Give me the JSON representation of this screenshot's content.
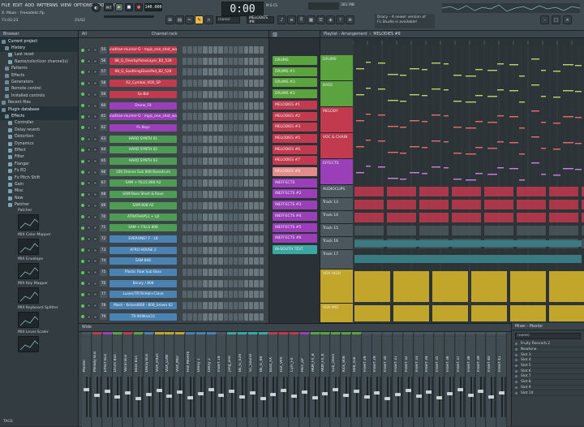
{
  "menu": {
    "items": [
      "FILE",
      "EDIT",
      "ADD",
      "PATTERNS",
      "VIEW",
      "OPTIONS",
      "TOOLS",
      "HELP"
    ]
  },
  "project": {
    "name": "X. Moon - Freeadelic.flp",
    "time": "71:02:23",
    "status": "21/02"
  },
  "transport": {
    "pat_label": "PAT",
    "song_label": "SONG",
    "tempo": "140.000",
    "time_display": "0:00",
    "time_sub": "M:S:CS",
    "cpu": "381 MB",
    "pattern_selector": "MELODIES #8",
    "snap": "(none)"
  },
  "news": {
    "text1": "Dracy - A newer version of",
    "text2": "FL Studio is available!"
  },
  "browser": {
    "title": "Browser",
    "items": [
      {
        "label": "Current project",
        "kind": "folder",
        "hi": true
      },
      {
        "label": "History",
        "kind": "folder",
        "hi": true
      },
      {
        "label": "Last reset",
        "kind": "item",
        "hi": false
      },
      {
        "label": "Name/color/icon channel(s)",
        "kind": "item",
        "hi": false
      },
      {
        "label": "Patterns",
        "kind": "folder",
        "hi": false
      },
      {
        "label": "Effects",
        "kind": "folder",
        "hi": false
      },
      {
        "label": "Generators",
        "kind": "folder",
        "hi": false
      },
      {
        "label": "Remote control",
        "kind": "folder",
        "hi": false
      },
      {
        "label": "Installed controls",
        "kind": "folder",
        "hi": false
      },
      {
        "label": "Recent files",
        "kind": "folder",
        "hi": false
      },
      {
        "label": "Plugin database",
        "kind": "folder",
        "hi": true
      },
      {
        "label": "Effects",
        "kind": "folder",
        "hi": true
      },
      {
        "label": "Controller",
        "kind": "item",
        "hi": false
      },
      {
        "label": "Delay reverb",
        "kind": "item",
        "hi": false
      },
      {
        "label": "Distortion",
        "kind": "item",
        "hi": false
      },
      {
        "label": "Dynamics",
        "kind": "item",
        "hi": false
      },
      {
        "label": "Effect",
        "kind": "item",
        "hi": false
      },
      {
        "label": "Filter",
        "kind": "item",
        "hi": false
      },
      {
        "label": "Flanger",
        "kind": "item",
        "hi": false
      },
      {
        "label": "Fx EQ",
        "kind": "item",
        "hi": false
      },
      {
        "label": "Fx Pitch Shift",
        "kind": "item",
        "hi": false
      },
      {
        "label": "Gain",
        "kind": "item",
        "hi": false
      },
      {
        "label": "Misc",
        "kind": "item",
        "hi": false
      },
      {
        "label": "New",
        "kind": "item",
        "hi": false
      },
      {
        "label": "Patcher",
        "kind": "item",
        "hi": false
      }
    ],
    "plugins": [
      "Patcher",
      "MIX Color Mapper",
      "MIX Envelope",
      "MIX Key Mapper",
      "MIX Keyboard Splitter",
      "MIX Level Scaler"
    ],
    "footer": "TAGS"
  },
  "channel_rack": {
    "title": "Channel rack",
    "filter": "All",
    "channels": [
      {
        "num": "55",
        "name": "jonathan-murner-G - mpjs_one_shot_wav",
        "color": "#c23a4d"
      },
      {
        "num": "56",
        "name": "88_G_OnerbyPulseLayer_B2_528",
        "color": "#c23a4d"
      },
      {
        "num": "57",
        "name": "88_G_SoothingGlassPad_B2_528",
        "color": "#c23a4d"
      },
      {
        "num": "58",
        "name": "A2_Cymbal_VOX_SP",
        "color": "#c23a4d"
      },
      {
        "num": "59",
        "name": "Sx Bld",
        "color": "#c23a4d"
      },
      {
        "num": "60",
        "name": "Drone_F4",
        "color": "#9a3fb8"
      },
      {
        "num": "61",
        "name": "jonathan-murner-G - mpjs_one_shot_wav",
        "color": "#9a3fb8"
      },
      {
        "num": "62",
        "name": "FL Keys",
        "color": "#9a3fb8"
      },
      {
        "num": "63",
        "name": "HARD SYNTH 01",
        "color": "#4f9a54"
      },
      {
        "num": "64",
        "name": "HARD SYNTH 02",
        "color": "#4f9a54"
      },
      {
        "num": "65",
        "name": "HARD SYNTH 03",
        "color": "#4f9a54"
      },
      {
        "num": "66",
        "name": "106 Drones Sub 808 Basedrum",
        "color": "#4f9a54"
      },
      {
        "num": "67",
        "name": "SAM + FILLS 808 A2",
        "color": "#4f9a54"
      },
      {
        "num": "68",
        "name": "SAM Bass Short & Rave",
        "color": "#4f9a54"
      },
      {
        "num": "69",
        "name": "SAM 808 A2",
        "color": "#4f9a54"
      },
      {
        "num": "70",
        "name": "ATRATHAP51 + L8",
        "color": "#4f9a54"
      },
      {
        "num": "71",
        "name": "SAM + FILLS 808",
        "color": "#4f9a54"
      },
      {
        "num": "72",
        "name": "EVERONE? F - L8",
        "color": "#4a82b4"
      },
      {
        "num": "73",
        "name": "AFRO HOUSE 2",
        "color": "#4a82b4"
      },
      {
        "num": "74",
        "name": "SAM 808",
        "color": "#4a82b4"
      },
      {
        "num": "75",
        "name": "Plastic Raw Sub Bass",
        "color": "#4a82b4"
      },
      {
        "num": "76",
        "name": "Boney / 808",
        "color": "#4a82b4"
      },
      {
        "num": "77",
        "name": "Luxon/TR78-Hat+Clave",
        "color": "#4a82b4"
      },
      {
        "num": "78",
        "name": "Mash - Keland808 - 808_brown 02",
        "color": "#4a82b4"
      },
      {
        "num": "79",
        "name": "TR-909Kick11",
        "color": "#4a82b4"
      }
    ]
  },
  "patterns": [
    {
      "name": "DRUMS",
      "color": "#5aa33f"
    },
    {
      "name": "DRUMS #1",
      "color": "#5aa33f"
    },
    {
      "name": "DRUMS #3",
      "color": "#5aa33f"
    },
    {
      "name": "DRUMS #2",
      "color": "#5aa33f"
    },
    {
      "name": "MELODIES #1",
      "color": "#c23a4d"
    },
    {
      "name": "MELODIES #2",
      "color": "#c23a4d"
    },
    {
      "name": "MELODIES #3",
      "color": "#c23a4d"
    },
    {
      "name": "MELODIES #5",
      "color": "#c23a4d"
    },
    {
      "name": "MELODIES #6",
      "color": "#c23a4d"
    },
    {
      "name": "MELODIES #7",
      "color": "#c23a4d"
    },
    {
      "name": "MELODIES #8",
      "color": "#e58a8a"
    },
    {
      "name": "INEFFECTS",
      "color": "#9a3fb8"
    },
    {
      "name": "INEFFECTS #2",
      "color": "#9a3fb8"
    },
    {
      "name": "INEFFECTS #3",
      "color": "#9a3fb8"
    },
    {
      "name": "INEFFECTS #4",
      "color": "#9a3fb8"
    },
    {
      "name": "INEFFECTS #5",
      "color": "#9a3fb8"
    },
    {
      "name": "INEFFECTS #6",
      "color": "#9a3fb8"
    },
    {
      "name": "IN-SOUTH TEST",
      "color": "#3aa7a0"
    }
  ],
  "playlist": {
    "title": "Playlist - Arrangement",
    "pattern": "MELODIES #8",
    "tracks": [
      {
        "name": "DRUMS",
        "color": "#5aa33f"
      },
      {
        "name": "BASS",
        "color": "#5aa33f"
      },
      {
        "name": "MELODY",
        "color": "#c23a4d"
      },
      {
        "name": "VOC & CHAIN",
        "color": "#c23a4d"
      },
      {
        "name": "EFFECTS",
        "color": "#9a3fb8"
      },
      {
        "name": "AUDIOCLIPS",
        "color": "#4b575c"
      },
      {
        "name": "Track 13",
        "color": "#4b575c"
      },
      {
        "name": "Track 14",
        "color": "#4b575c"
      },
      {
        "name": "Track 15",
        "color": "#4b575c"
      },
      {
        "name": "Track 16",
        "color": "#4b575c"
      },
      {
        "name": "Track 17",
        "color": "#4b575c"
      },
      {
        "name": "VOX HIGH",
        "color": "#c2a62c"
      },
      {
        "name": "VOX MID",
        "color": "#c2a62c"
      }
    ],
    "clip_labels": [
      "Vocal Sam Box - Volume",
      "Balance - Vocal Sam Box - Volume",
      "FL Keys - volume",
      "LFO - volume",
      "LFO - volume",
      "LFO - volume",
      "Vocal_Chord",
      "LFO_Chord"
    ]
  },
  "mixer": {
    "title": "Mixer - Master",
    "mode": "Wide",
    "channels": [
      "Master",
      "Melody Bus",
      "Effect Bus",
      "Drum Bus",
      "Vocal Bus",
      "Bass Bus",
      "Delay Bus",
      "VOX_HIGH",
      "VOX_LOW",
      "VOX_MID",
      "Hall Reverb",
      "Delay 1",
      "Delay 2",
      "Insert 14",
      "jang_one",
      "BE_G_028",
      "SC_Sound",
      "BE_G_B8",
      "Bass_FX",
      "Hat_VPX",
      "Cym_FX",
      "Perc_LP",
      "AKM_FX_B",
      "AKM_FX_K",
      "Sub_clean",
      "Kick_808",
      "808_sub",
      "Insert 28",
      "Insert 29",
      "Insert 30",
      "Insert 31",
      "Insert 32",
      "Insert 33",
      "Insert 34",
      "Insert 35",
      "Insert 36",
      "Insert 37",
      "Insert 38",
      "Insert 39",
      "Insert 40",
      "Insert 41"
    ],
    "strip_colors": [
      "#4b575c",
      "#c23a4d",
      "#9a3fb8",
      "#5aa33f",
      "#c23a4d",
      "#5aa33f",
      "#4a82b4",
      "#c2a62c",
      "#c2a62c",
      "#c2a62c",
      "#4a82b4",
      "#4a82b4",
      "#4a82b4",
      "#4b575c",
      "#3aa7a0",
      "#3aa7a0",
      "#3aa7a0",
      "#3aa7a0",
      "#c23a4d",
      "#c23a4d",
      "#c23a4d",
      "#9a3fb8",
      "#5aa33f",
      "#5aa33f",
      "#5aa33f",
      "#5aa33f",
      "#5aa33f",
      "#4b575c",
      "#4b575c",
      "#4b575c",
      "#4b575c",
      "#4b575c",
      "#4b575c",
      "#4b575c",
      "#4b575c",
      "#4b575c",
      "#4b575c",
      "#4b575c",
      "#4b575c",
      "#4b575c",
      "#4b575c"
    ]
  },
  "master": {
    "title": "Mixer - Master",
    "preset": "(none)",
    "slots": [
      "Fruity Reeverb 2",
      "Newtone",
      "Slot 3",
      "Slot 4",
      "Slot 5",
      "Slot 6",
      "Slot 7",
      "Slot 8",
      "Slot 9",
      "Slot 10"
    ]
  }
}
